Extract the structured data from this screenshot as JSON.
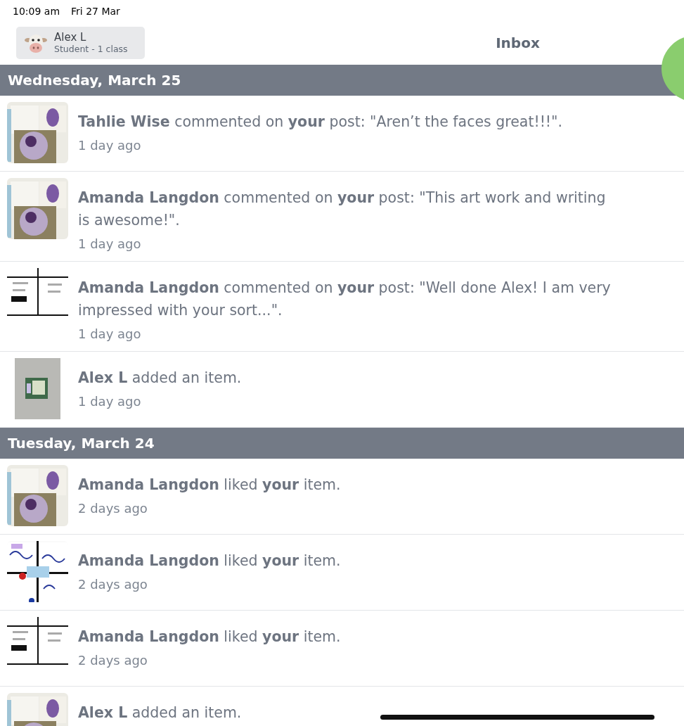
{
  "status_bar": {
    "time": "10:09 am",
    "date": "Fri 27 Mar"
  },
  "header": {
    "user_name": "Alex L",
    "user_subtitle": "Student - 1 class",
    "title": "Inbox"
  },
  "sections": [
    {
      "date": "Wednesday, March 25",
      "items": [
        {
          "message": "**Tahlie Wise** commented on **your** post: \"Aren’t the faces great!!!\".",
          "time": "1 day ago"
        },
        {
          "message": "**Amanda Langdon** commented on **your** post: \"This art work and writing is awesome!\".",
          "time": "1 day ago"
        },
        {
          "message": "**Amanda Langdon** commented on **your** post: \"Well done Alex! I am very impressed with your sort...\".",
          "time": "1 day ago"
        },
        {
          "message": "**Alex L** added an item.",
          "time": "1 day ago"
        }
      ]
    },
    {
      "date": "Tuesday, March 24",
      "items": [
        {
          "message": "**Amanda Langdon** liked **your** item.",
          "time": "2 days ago"
        },
        {
          "message": "**Amanda Langdon** liked **your** item.",
          "time": "2 days ago"
        },
        {
          "message": "**Amanda Langdon** liked **your** item.",
          "time": "2 days ago"
        },
        {
          "message": "**Alex L** added an item."
        }
      ]
    }
  ]
}
